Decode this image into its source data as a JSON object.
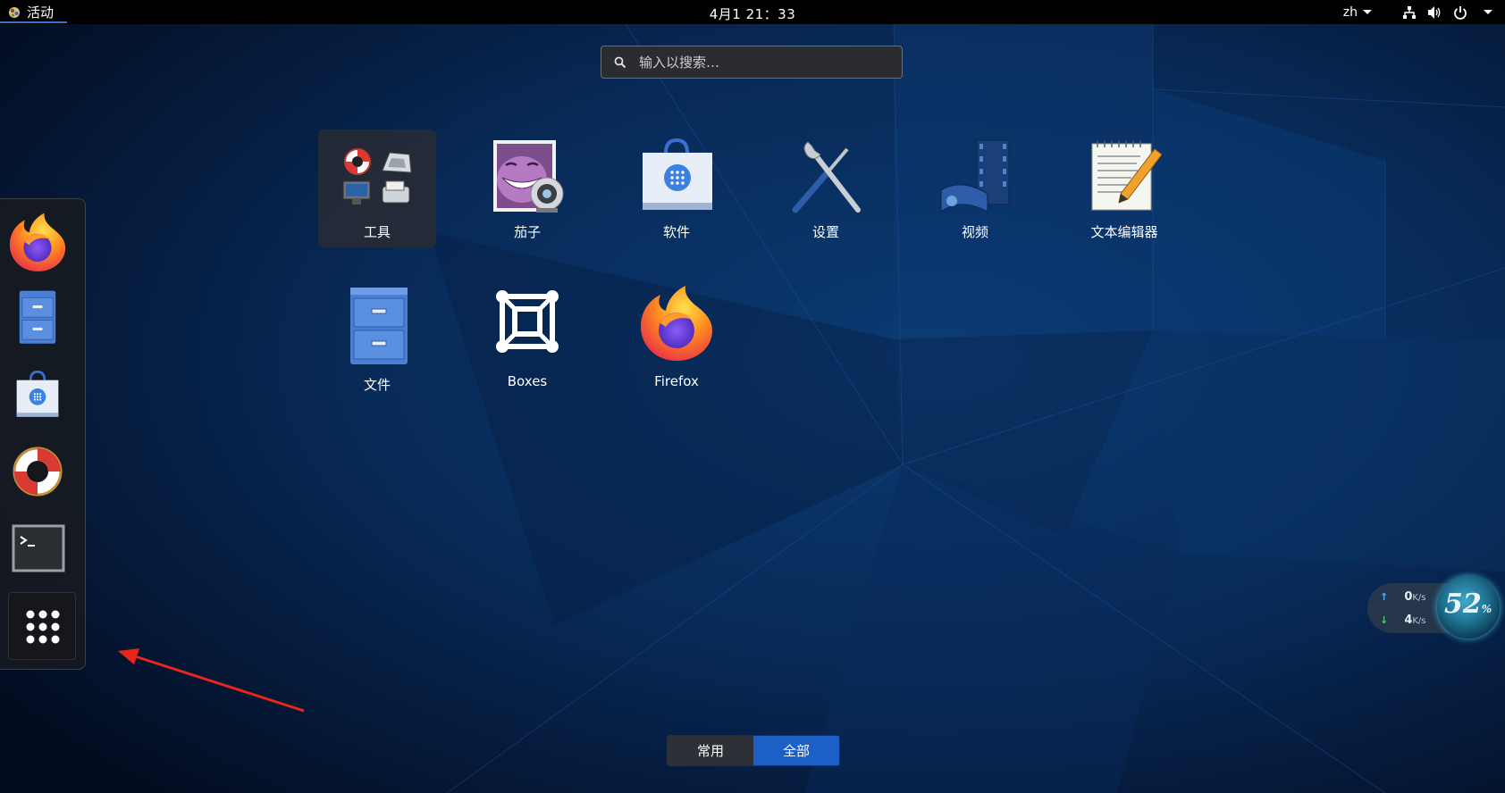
{
  "topbar": {
    "activities_label": "活动",
    "clock": "4月1  21：33",
    "lang": "zh"
  },
  "search": {
    "placeholder": "输入以搜索…"
  },
  "apps": [
    {
      "label": "工具",
      "icon": "utilities-folder-icon"
    },
    {
      "label": "茄子",
      "icon": "cheese-webcam-icon"
    },
    {
      "label": "软件",
      "icon": "software-store-icon"
    },
    {
      "label": "设置",
      "icon": "settings-tools-icon"
    },
    {
      "label": "视频",
      "icon": "video-film-icon"
    },
    {
      "label": "文本编辑器",
      "icon": "text-editor-icon"
    },
    {
      "label": "文件",
      "icon": "file-cabinet-icon"
    },
    {
      "label": "Boxes",
      "icon": "boxes-icon"
    },
    {
      "label": "Firefox",
      "icon": "firefox-icon"
    }
  ],
  "dash": {
    "items": [
      "firefox-icon",
      "files-icon",
      "software-icon",
      "help-lifebuoy-icon",
      "terminal-icon",
      "show-apps-grid-icon"
    ]
  },
  "view_switch": {
    "frequent_label": "常用",
    "all_label": "全部"
  },
  "net_widget": {
    "upload_value": "0",
    "upload_unit": "K/s",
    "download_value": "4",
    "download_unit": "K/s",
    "percent": "52",
    "percent_unit": "%"
  },
  "colors": {
    "accent": "#1b5fc7",
    "annotation_arrow": "#e8261c"
  }
}
